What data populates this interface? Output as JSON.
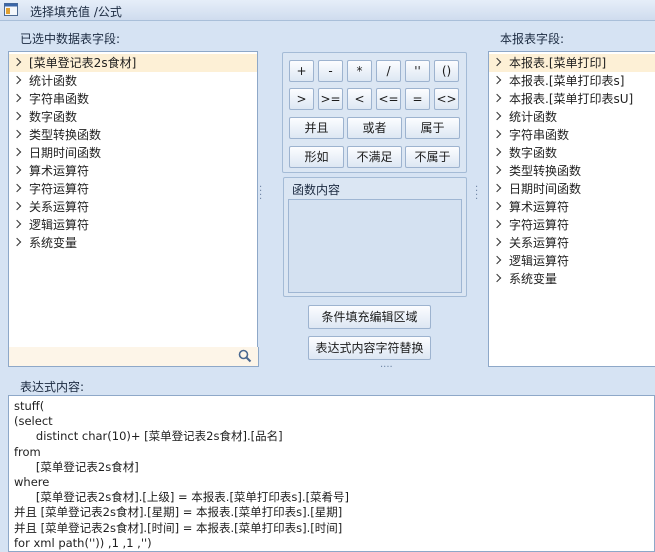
{
  "window": {
    "title": "选择填充值 /公式"
  },
  "left_panel": {
    "caption": "已选中数据表字段:",
    "items": [
      "[菜单登记表2s食材]",
      "统计函数",
      "字符串函数",
      "数字函数",
      "类型转换函数",
      "日期时间函数",
      "算术运算符",
      "字符运算符",
      "关系运算符",
      "逻辑运算符",
      "系统变量"
    ],
    "search": {
      "value": ""
    }
  },
  "operators": {
    "row1": [
      "+",
      "-",
      "*",
      "/",
      "''",
      "()"
    ],
    "row2": [
      ">",
      ">=",
      "<",
      "<=",
      "=",
      "<>"
    ],
    "row3": [
      "并且",
      "或者",
      "属于"
    ],
    "row4": [
      "形如",
      "不满足",
      "不属于"
    ]
  },
  "function_panel": {
    "legend": "函数内容",
    "content": ""
  },
  "actions": {
    "condition_edit": "条件填充编辑区域",
    "replace_chars": "表达式内容字符替换"
  },
  "right_panel": {
    "caption": "本报表字段:",
    "items": [
      "本报表.[菜单打印]",
      "本报表.[菜单打印表s]",
      "本报表.[菜单打印表sU]",
      "统计函数",
      "字符串函数",
      "数字函数",
      "类型转换函数",
      "日期时间函数",
      "算术运算符",
      "字符运算符",
      "关系运算符",
      "逻辑运算符",
      "系统变量"
    ]
  },
  "expression": {
    "caption": "表达式内容:",
    "text": "stuff(\n(select\n      distinct char(10)+ [菜单登记表2s食材].[品名]\nfrom\n      [菜单登记表2s食材]\nwhere\n      [菜单登记表2s食材].[上级] = 本报表.[菜单打印表s].[菜肴号]\n并且 [菜单登记表2s食材].[星期] = 本报表.[菜单打印表s].[星期]\n并且 [菜单登记表2s食材].[时间] = 本报表.[菜单打印表s].[时间]\nfor xml path('')) ,1 ,1 ,'')"
  }
}
